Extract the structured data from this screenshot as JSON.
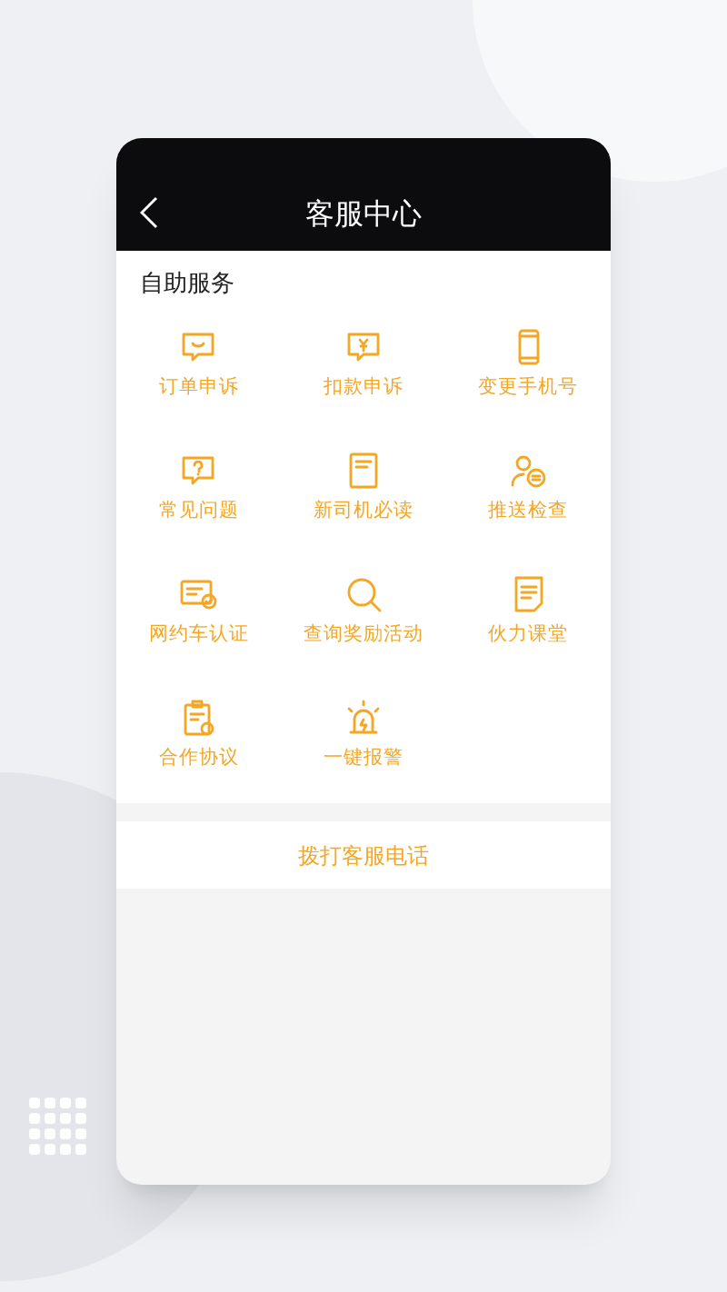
{
  "header": {
    "title": "客服中心"
  },
  "section": {
    "title": "自助服务",
    "items": [
      {
        "label": "订单申诉",
        "kind": "chat"
      },
      {
        "label": "扣款申诉",
        "kind": "payment"
      },
      {
        "label": "变更手机号",
        "kind": "phone"
      },
      {
        "label": "常见问题",
        "kind": "question"
      },
      {
        "label": "新司机必读",
        "kind": "book"
      },
      {
        "label": "推送检查",
        "kind": "user"
      },
      {
        "label": "网约车认证",
        "kind": "card"
      },
      {
        "label": "查询奖励活动",
        "kind": "search"
      },
      {
        "label": "伙力课堂",
        "kind": "note"
      },
      {
        "label": "合作协议",
        "kind": "clipboard"
      },
      {
        "label": "一键报警",
        "kind": "alarm"
      }
    ]
  },
  "call_button": {
    "label": "拨打客服电话"
  }
}
